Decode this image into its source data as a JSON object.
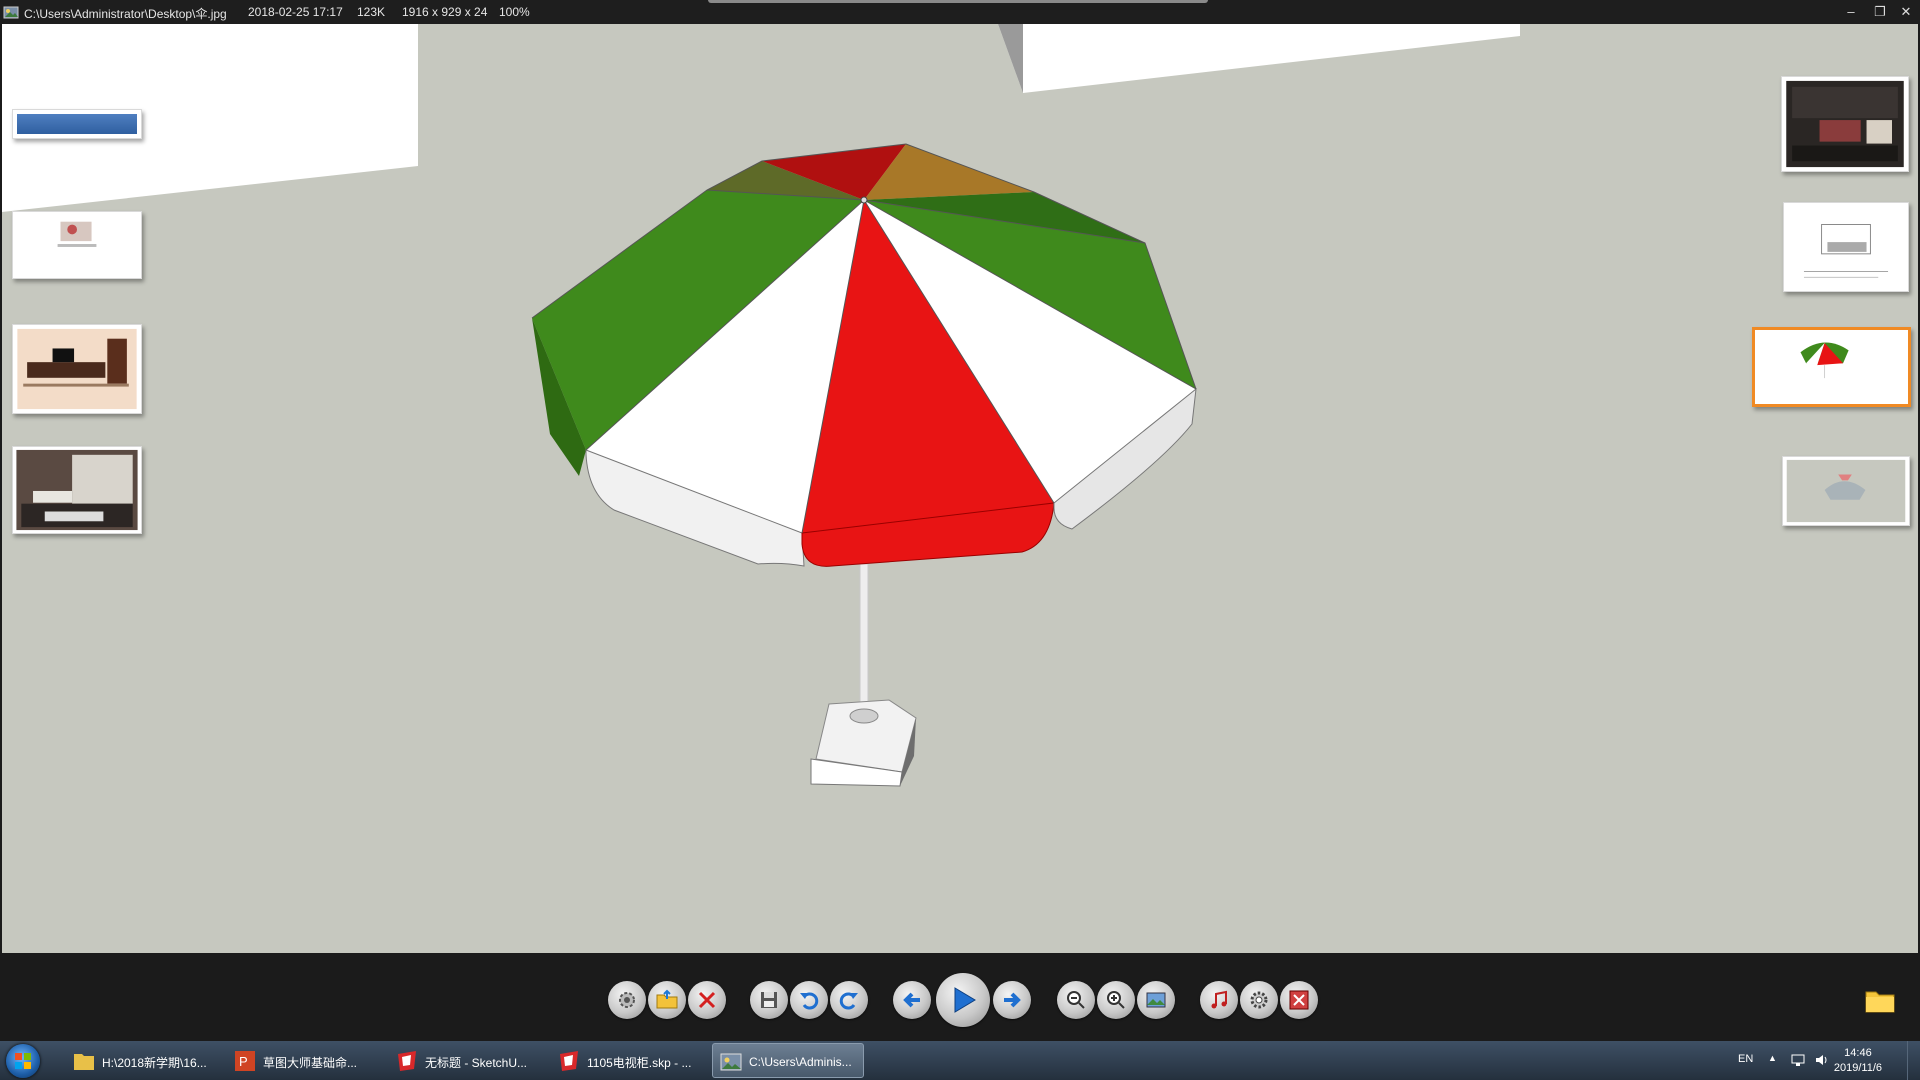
{
  "titlebar": {
    "path": "C:\\Users\\Administrator\\Desktop\\伞.jpg",
    "date": "2018-02-25 17:17",
    "size": "123K",
    "dimensions": "1916 x 929 x 24",
    "zoom": "100%",
    "buttons": {
      "minimize": "–",
      "restore": "❐",
      "close": "✕"
    }
  },
  "toolbar": {
    "groups": [
      [
        "settings-icon",
        "open-folder-icon",
        "delete-icon"
      ],
      [
        "save-icon",
        "rotate-left-icon",
        "rotate-right-icon"
      ],
      [
        "previous-arrow-icon",
        "play-icon",
        "next-arrow-icon"
      ],
      [
        "zoom-out-icon",
        "zoom-in-icon",
        "image-icon"
      ],
      [
        "music-icon",
        "gear-icon",
        "fullscreen-icon"
      ]
    ],
    "folder": "folder-icon"
  },
  "taskbar": {
    "tasks": [
      {
        "label": "H:\\2018新学期\\16...",
        "icon": "folder-icon"
      },
      {
        "label": "草图大师基础命...",
        "icon": "powerpoint-icon"
      },
      {
        "label": "无标题 - SketchU...",
        "icon": "sketchup-icon"
      },
      {
        "label": "1105电视柜.skp - ...",
        "icon": "sketchup-icon"
      },
      {
        "label": "C:\\Users\\Adminis...",
        "icon": "image-viewer-icon",
        "active": true
      }
    ],
    "tray": {
      "lang": "EN",
      "time": "14:46",
      "date": "2019/11/6"
    }
  },
  "colors": {
    "canvas": "#c6c8bf",
    "selection": "#f08a24",
    "red": "#e81414",
    "green": "#3f8a1c"
  }
}
